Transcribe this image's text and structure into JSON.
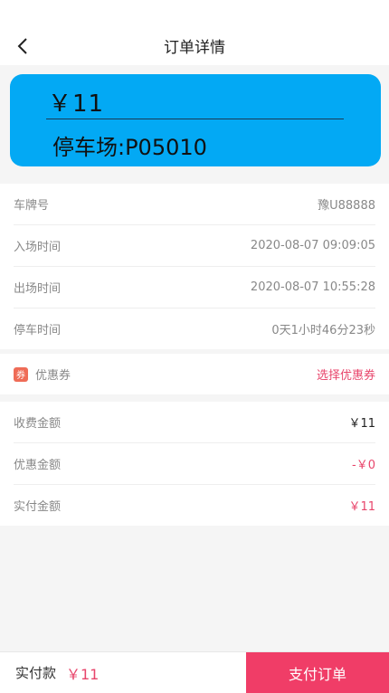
{
  "header": {
    "title": "订单详情",
    "back_icon": "chevron-left-icon"
  },
  "card": {
    "amount": "￥11",
    "parking_lot": "停车场:P05010",
    "background_color": "#03a9f4"
  },
  "details": [
    {
      "label": "车牌号",
      "value": "豫U88888"
    },
    {
      "label": "入场时间",
      "value": "2020-08-07 09:09:05"
    },
    {
      "label": "出场时间",
      "value": "2020-08-07 10:55:28"
    },
    {
      "label": "停车时间",
      "value": "0天1小时46分23秒"
    }
  ],
  "coupon": {
    "badge": "券",
    "label": "优惠券",
    "action": "选择优惠券"
  },
  "fees": [
    {
      "label": "收费金额",
      "value": "￥11"
    },
    {
      "label": "优惠金额",
      "value": "-￥0"
    },
    {
      "label": "实付金额",
      "value": "￥11"
    }
  ],
  "bottom": {
    "pay_label": "实付款",
    "pay_amount": "￥11",
    "pay_button": "支付订单",
    "accent_color": "#f03d67"
  }
}
